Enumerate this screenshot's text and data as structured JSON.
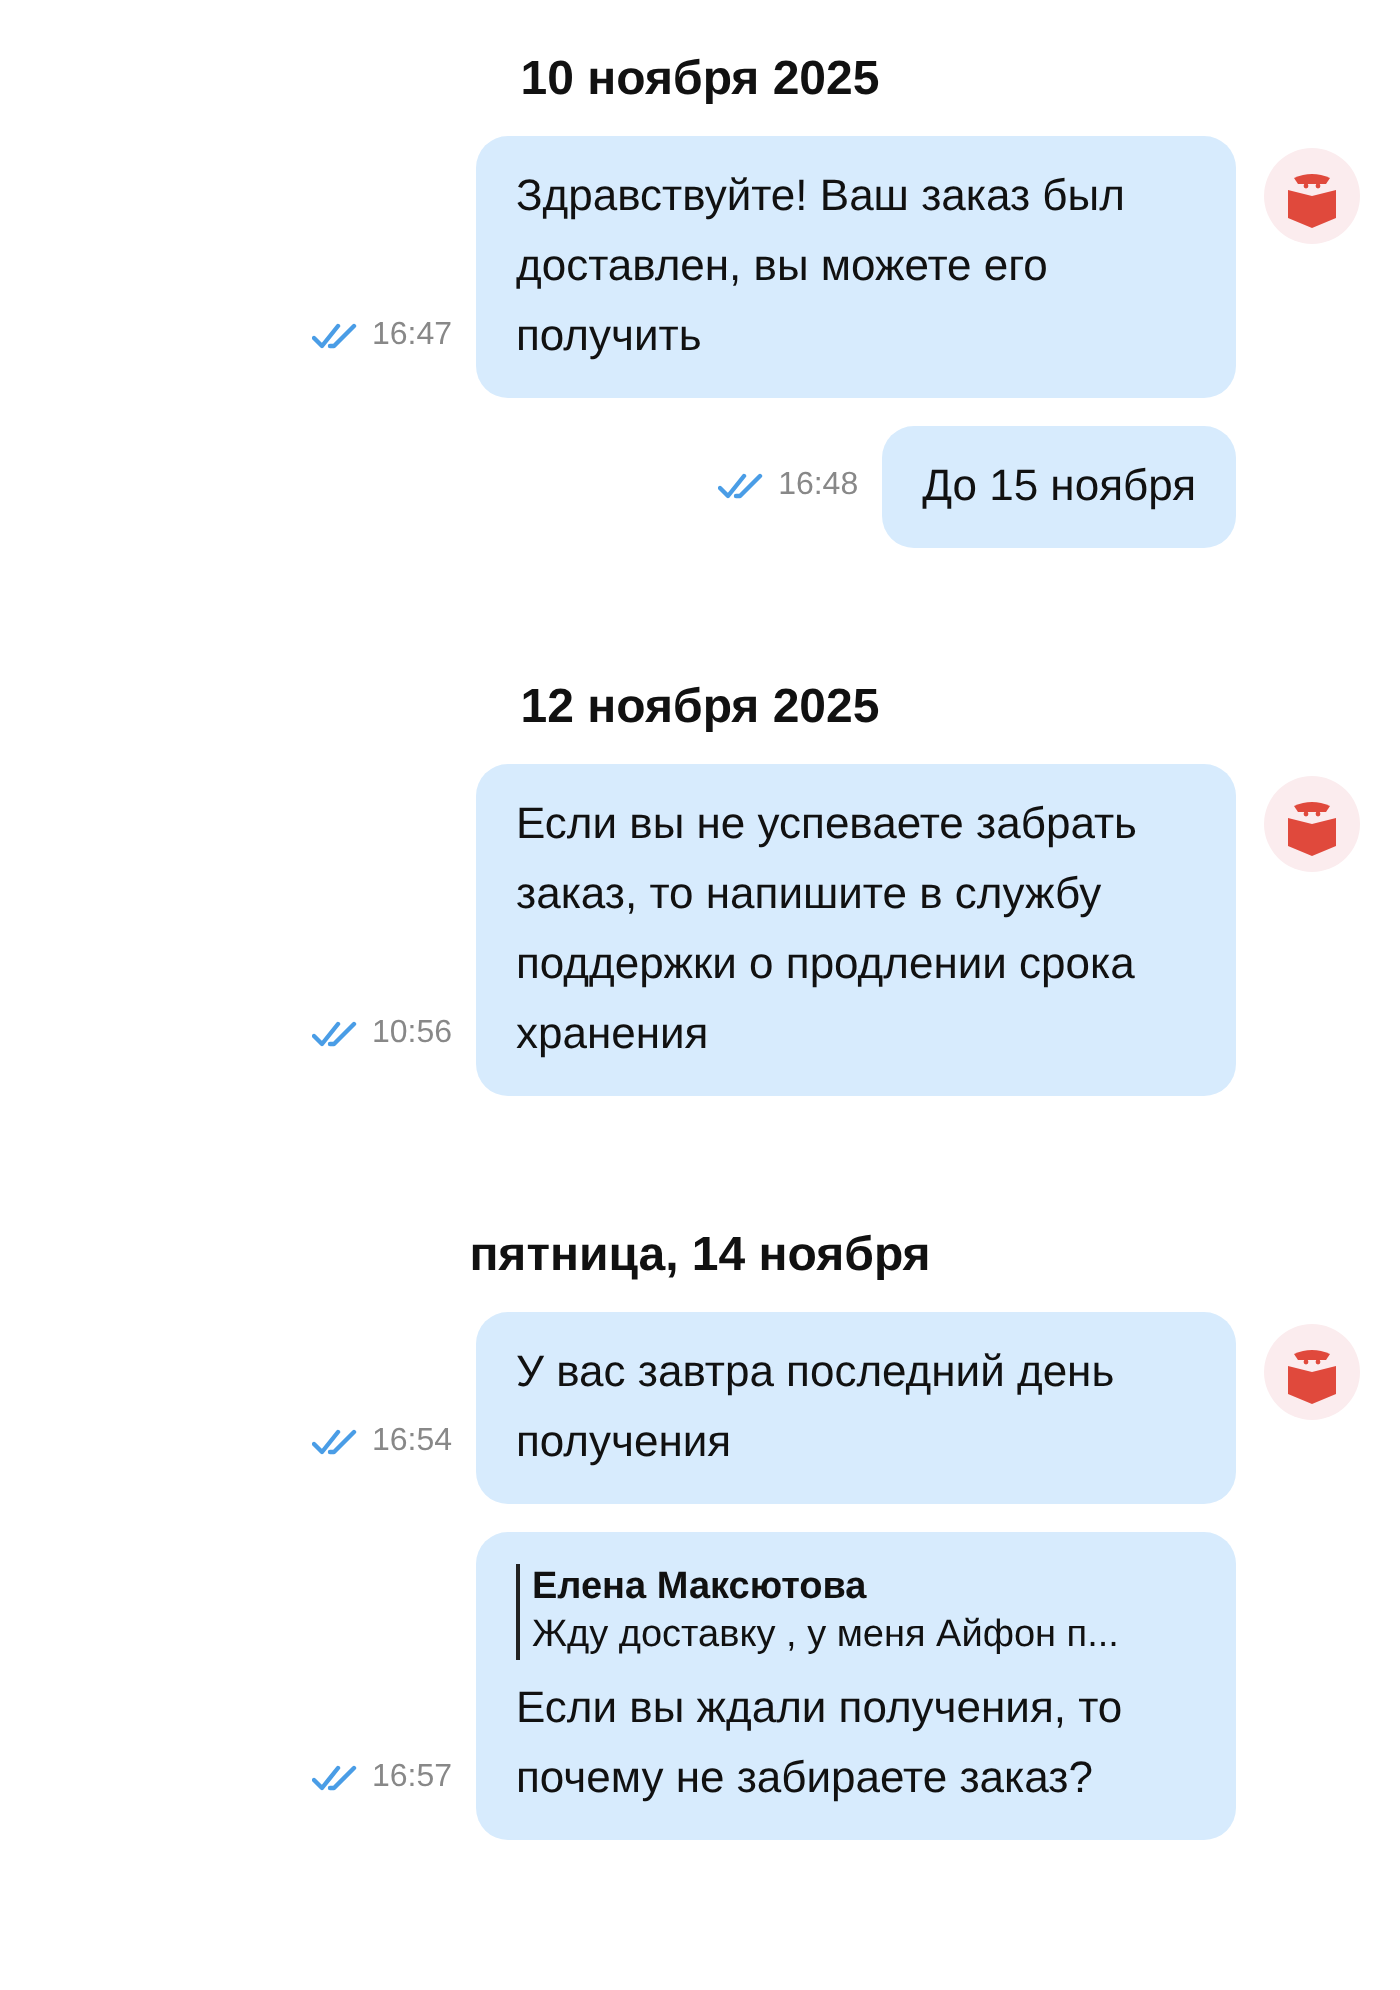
{
  "groups": [
    {
      "date": "10 ноября 2025",
      "messages": [
        {
          "text": "Здравствуйте! Ваш заказ был доставлен, вы можете его получить",
          "time": "16:47",
          "read": true,
          "avatar": true
        },
        {
          "text": "До 15 ноября",
          "time": "16:48",
          "read": true,
          "avatar": false
        }
      ]
    },
    {
      "date": "12 ноября 2025",
      "messages": [
        {
          "text": "Если вы не успеваете забрать заказ, то напишите в службу поддержки о продлении срока хранения",
          "time": "10:56",
          "read": true,
          "avatar": true
        }
      ]
    },
    {
      "date": "пятница, 14 ноября",
      "messages": [
        {
          "text": "У вас завтра последний день получения",
          "time": "16:54",
          "read": true,
          "avatar": true
        },
        {
          "text": "Если вы ждали получения, то почему не забираете заказ?",
          "time": "16:57",
          "read": true,
          "avatar": false,
          "reply": {
            "author": "Елена Максютова",
            "text": "Жду доставку , у меня  Айфон п..."
          }
        }
      ]
    }
  ]
}
